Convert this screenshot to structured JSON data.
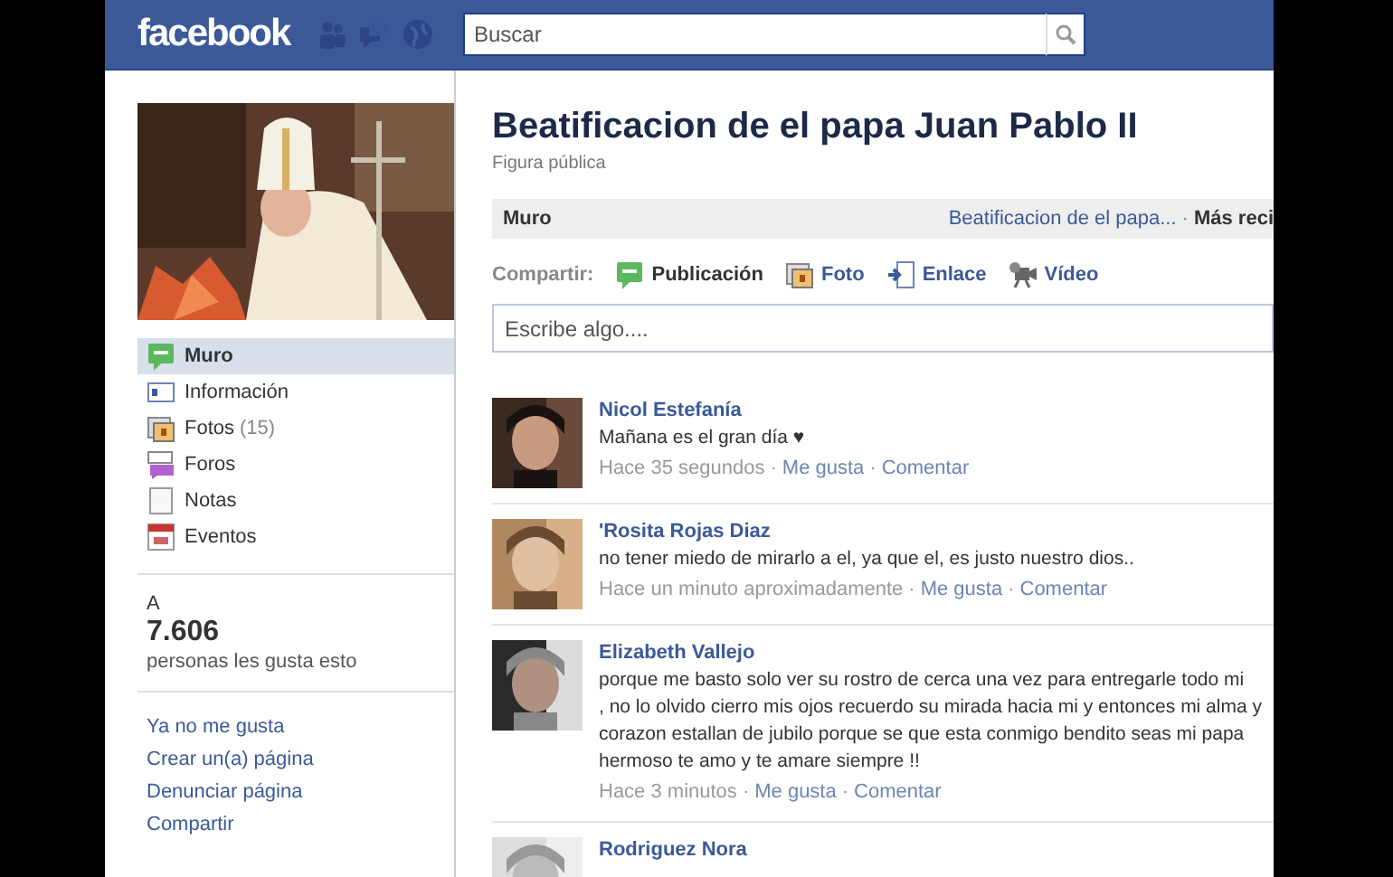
{
  "header": {
    "logo": "facebook",
    "search": {
      "placeholder": "Buscar"
    }
  },
  "sidebar": {
    "nav": [
      {
        "label": "Muro",
        "selected": true
      },
      {
        "label": "Información",
        "selected": false
      },
      {
        "label": "Fotos",
        "count": "(15)",
        "selected": false
      },
      {
        "label": "Foros",
        "selected": false
      },
      {
        "label": "Notas",
        "selected": false
      },
      {
        "label": "Eventos",
        "selected": false
      }
    ],
    "likes": {
      "prefix": "A",
      "count": "7.606",
      "caption": "personas les gusta esto"
    },
    "links": [
      "Ya no me gusta",
      "Crear un(a) página",
      "Denunciar página",
      "Compartir"
    ]
  },
  "page": {
    "title": "Beatificacion de el papa Juan Pablo II",
    "category": "Figura pública",
    "wall_bar": {
      "tab": "Muro",
      "filter": "Beatificacion de el papa...",
      "separator": "·",
      "sort": "Más reci"
    },
    "share": {
      "label": "Compartir:",
      "options": [
        {
          "label": "Publicación",
          "selected": true
        },
        {
          "label": "Foto",
          "selected": false
        },
        {
          "label": "Enlace",
          "selected": false
        },
        {
          "label": "Vídeo",
          "selected": false
        }
      ]
    },
    "composer": {
      "placeholder": "Escribe algo...."
    },
    "meta_separator": "·",
    "posts": [
      {
        "author": "Nicol Estefanía",
        "lines": [
          "Mañana es el gran día ♥"
        ],
        "time": "Hace 35 segundos",
        "actions": [
          "Me gusta",
          "Comentar"
        ]
      },
      {
        "author": "'Rosita Rojas Diaz",
        "lines": [
          "no tener miedo de mirarlo a el, ya que el, es justo nuestro dios.."
        ],
        "time": "Hace un minuto aproximadamente",
        "actions": [
          "Me gusta",
          "Comentar"
        ]
      },
      {
        "author": "Elizabeth Vallejo",
        "lines": [
          "porque me basto solo ver su rostro de cerca una vez para entregarle todo mi",
          ", no lo olvido cierro mis ojos recuerdo su mirada hacia mi y entonces mi alma y",
          "corazon estallan de jubilo porque se que esta conmigo bendito seas mi papa",
          "hermoso te amo y te amare siempre !!"
        ],
        "time": "Hace 3 minutos",
        "actions": [
          "Me gusta",
          "Comentar"
        ]
      },
      {
        "author": "Rodriguez Nora"
      }
    ]
  }
}
